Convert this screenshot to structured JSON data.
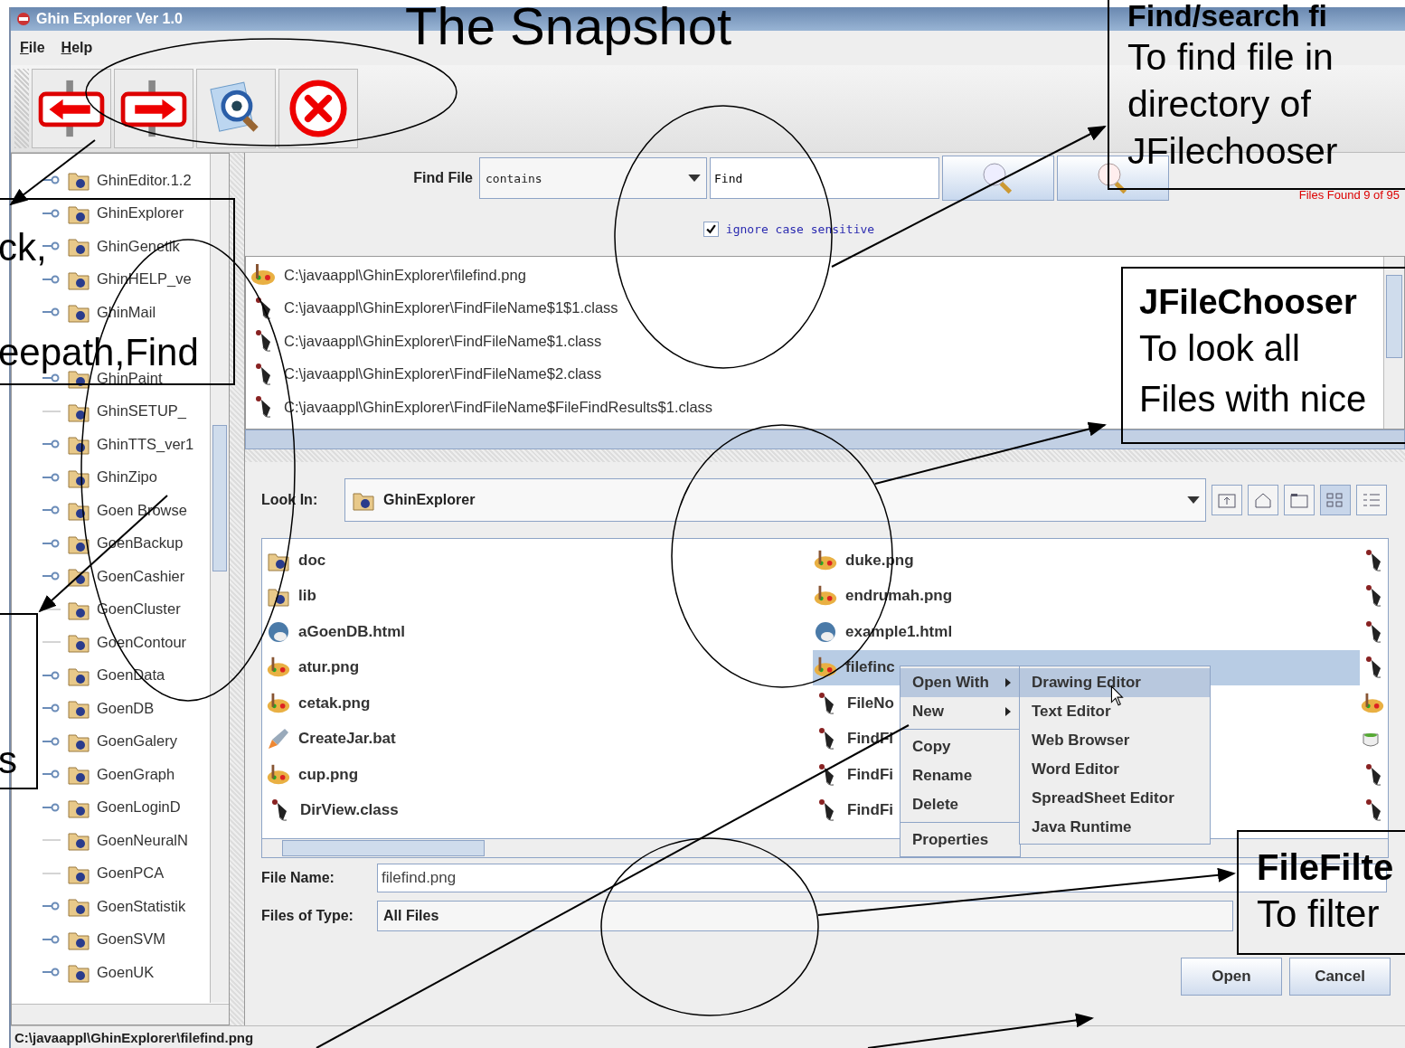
{
  "slide": {
    "title": "The Snapshot"
  },
  "window": {
    "title": "Ghin Explorer Ver 1.0"
  },
  "menu": [
    "File",
    "Help"
  ],
  "toolbar": [
    {
      "kind": "back"
    },
    {
      "kind": "forward"
    },
    {
      "kind": "view"
    },
    {
      "kind": "exit"
    }
  ],
  "tree": {
    "items": [
      {
        "label": "GhinEditor.1.2",
        "expandable": true
      },
      {
        "label": "GhinExplorer",
        "expandable": true
      },
      {
        "label": "GhinGenetik",
        "expandable": true
      },
      {
        "label": "GhinHELP_ve",
        "expandable": true
      },
      {
        "label": "GhinMail",
        "expandable": true
      },
      {
        "label": "GhinPaint",
        "expandable": true
      },
      {
        "label": "GhinSETUP_",
        "expandable": false
      },
      {
        "label": "GhinTTS_ver1",
        "expandable": true
      },
      {
        "label": "GhinZipo",
        "expandable": true
      },
      {
        "label": "Goen Browse",
        "expandable": true
      },
      {
        "label": "GoenBackup",
        "expandable": true
      },
      {
        "label": "GoenCashier",
        "expandable": true
      },
      {
        "label": "GoenCluster",
        "expandable": false
      },
      {
        "label": "GoenContour",
        "expandable": false
      },
      {
        "label": "GoenData",
        "expandable": true
      },
      {
        "label": "GoenDB",
        "expandable": true
      },
      {
        "label": "GoenGalery",
        "expandable": true
      },
      {
        "label": "GoenGraph",
        "expandable": true
      },
      {
        "label": "GoenLoginD",
        "expandable": true
      },
      {
        "label": "GoenNeuralN",
        "expandable": false
      },
      {
        "label": "GoenPCA",
        "expandable": false
      },
      {
        "label": "GoenStatistik",
        "expandable": true
      },
      {
        "label": "GoenSVM",
        "expandable": true
      },
      {
        "label": "GoenUK",
        "expandable": true
      }
    ]
  },
  "find": {
    "label": "Find File",
    "mode": "contains",
    "query": "Find",
    "count": "Files Found 9 of 95",
    "ignore_case": {
      "label": "ignore case sensitive",
      "checked": true
    },
    "results": [
      {
        "path": "C:\\javaappl\\GhinExplorer\\filefind.png",
        "kind": "image"
      },
      {
        "path": "C:\\javaappl\\GhinExplorer\\FindFileName$1$1.class",
        "kind": "class"
      },
      {
        "path": "C:\\javaappl\\GhinExplorer\\FindFileName$1.class",
        "kind": "class"
      },
      {
        "path": "C:\\javaappl\\GhinExplorer\\FindFileName$2.class",
        "kind": "class"
      },
      {
        "path": "C:\\javaappl\\GhinExplorer\\FindFileName$FileFindResults$1.class",
        "kind": "class"
      }
    ]
  },
  "chooser": {
    "look_in_label": "Look In:",
    "look_in": "GhinExplorer",
    "view_buttons": [
      {
        "kind": "up",
        "selected": false
      },
      {
        "kind": "home",
        "selected": false
      },
      {
        "kind": "new-folder",
        "selected": false
      },
      {
        "kind": "list",
        "selected": true
      },
      {
        "kind": "details",
        "selected": false
      }
    ],
    "files": [
      {
        "name": "doc",
        "kind": "folder",
        "selected": false
      },
      {
        "name": "lib",
        "kind": "folder",
        "selected": false
      },
      {
        "name": "aGoenDB.html",
        "kind": "html",
        "selected": false
      },
      {
        "name": "atur.png",
        "kind": "image",
        "selected": false
      },
      {
        "name": "cetak.png",
        "kind": "image",
        "selected": false
      },
      {
        "name": "CreateJar.bat",
        "kind": "script",
        "selected": false
      },
      {
        "name": "cup.png",
        "kind": "image",
        "selected": false
      },
      {
        "name": "DirView.class",
        "kind": "class",
        "selected": false
      },
      {
        "name": "duke.png",
        "kind": "image",
        "selected": false
      },
      {
        "name": "endrumah.png",
        "kind": "image",
        "selected": false
      },
      {
        "name": "example1.html",
        "kind": "html",
        "selected": false
      },
      {
        "name": "filefinc",
        "kind": "image",
        "selected": true
      },
      {
        "name": "FileNo",
        "kind": "class",
        "selected": false
      },
      {
        "name": "FindFi",
        "kind": "class",
        "selected": false
      },
      {
        "name": "FindFi",
        "kind": "class",
        "selected": false
      },
      {
        "name": "FindFi",
        "kind": "class",
        "selected": false
      },
      {
        "kind": "class",
        "selected": false
      },
      {
        "kind": "class",
        "selected": false
      },
      {
        "kind": "class",
        "selected": false
      },
      {
        "kind": "class",
        "selected": false
      },
      {
        "kind": "image",
        "selected": false
      },
      {
        "kind": "java",
        "selected": false
      },
      {
        "kind": "class",
        "selected": false
      },
      {
        "kind": "class",
        "selected": false
      }
    ],
    "file_name_label": "File Name:",
    "file_name": "filefind.png",
    "type_label": "Files of Type:",
    "type": "All Files",
    "buttons": [
      "Open",
      "Cancel"
    ]
  },
  "context_menu": {
    "groups": [
      [
        {
          "label": "Open With",
          "submenu": true,
          "selected": true
        },
        {
          "label": "New",
          "submenu": true,
          "selected": false
        }
      ],
      [
        {
          "label": "Copy",
          "submenu": false,
          "selected": false
        },
        {
          "label": "Rename",
          "submenu": false,
          "selected": false
        },
        {
          "label": "Delete",
          "submenu": false,
          "selected": false
        }
      ],
      [
        {
          "label": "Properties",
          "submenu": false,
          "selected": false
        }
      ]
    ],
    "submenu": [
      {
        "label": "Drawing Editor",
        "selected": true
      },
      {
        "label": "Text Editor",
        "selected": false
      },
      {
        "label": "Web Browser",
        "selected": false
      },
      {
        "label": "Word Editor",
        "selected": false
      },
      {
        "label": "SpreadSheet Editor",
        "selected": false
      },
      {
        "label": "Java Runtime",
        "selected": false
      }
    ]
  },
  "status_bar": "C:\\javaappl\\GhinExplorer\\filefind.png",
  "callouts": [
    {
      "heading": "Find/search fi",
      "lines": [
        "To find file in",
        "directory of",
        "JFilechooser"
      ]
    },
    {
      "heading": "JFileChooser",
      "lines": [
        "To look all",
        "Files with nice"
      ]
    },
    {
      "heading": "FileFilte",
      "lines": [
        "To filter"
      ]
    },
    {
      "lines": [
        "ck,",
        "eepath,Find"
      ]
    },
    {
      "lines": [
        "s"
      ]
    }
  ]
}
